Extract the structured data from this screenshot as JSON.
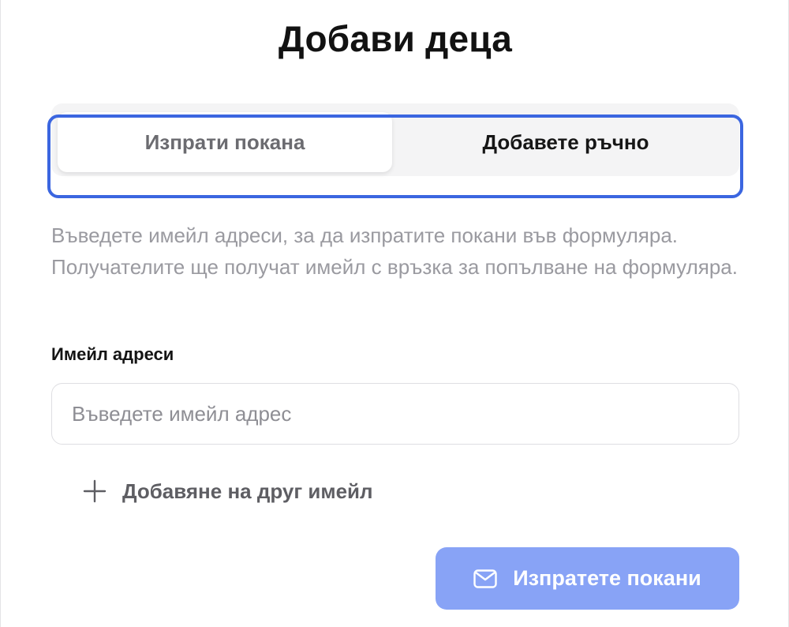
{
  "dialog": {
    "title": "Добави деца"
  },
  "tabs": [
    {
      "label": "Изпрати покана",
      "selected": true
    },
    {
      "label": "Добавете ръчно",
      "selected": false
    }
  ],
  "description": "Въведете имейл адреси, за да изпратите покани във формуляра. Получателите ще получат имейл с връзка за попълване на формуляра.",
  "emails": {
    "label": "Имейл адреси",
    "value": "",
    "placeholder": "Въведете имейл адрес",
    "add_label": "Добавяне на друг имейл"
  },
  "actions": {
    "send_label": "Изпратете покани"
  },
  "icons": {
    "add": "plus-icon",
    "send": "mail-icon"
  },
  "colors": {
    "accent": "#3b66e0",
    "button": "#88a3f6"
  }
}
